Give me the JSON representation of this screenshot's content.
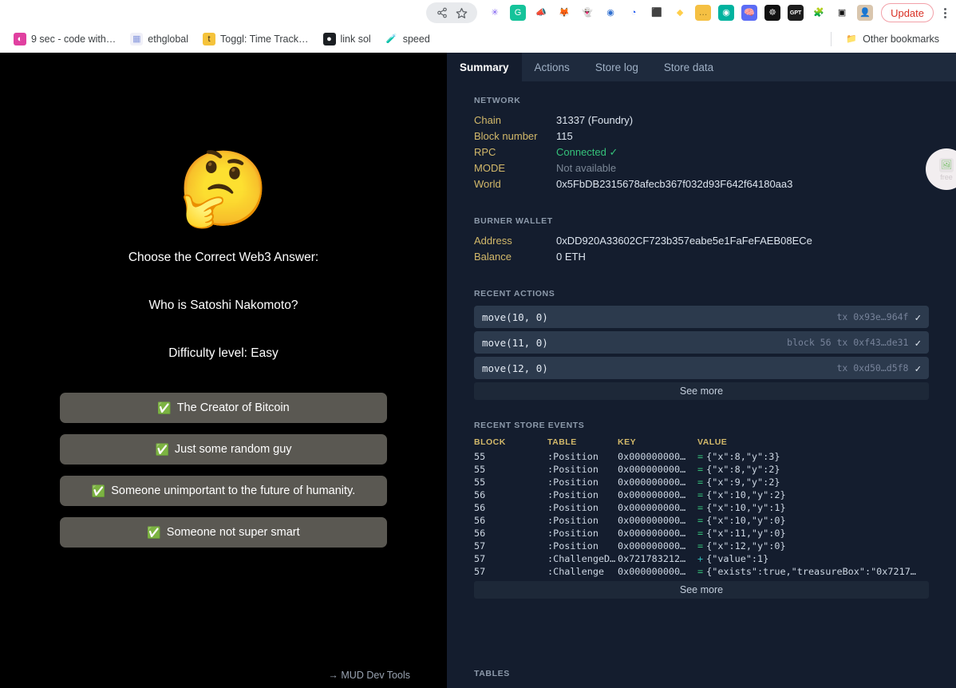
{
  "browser": {
    "omnibox_actions": [
      {
        "name": "share-icon",
        "glyph": "↪"
      },
      {
        "name": "bookmark-star-icon",
        "glyph": "☆"
      }
    ],
    "extensions": [
      {
        "name": "sun-extension-icon",
        "glyph": "✳",
        "color": "#7b5cf0",
        "bg": "#ffffff"
      },
      {
        "name": "grammarly-extension-icon",
        "glyph": "G",
        "color": "#ffffff",
        "bg": "#15c39a"
      },
      {
        "name": "megaphone-extension-icon",
        "glyph": "📣",
        "color": "#222222",
        "bg": "#ffffff"
      },
      {
        "name": "metamask-extension-icon",
        "glyph": "🦊",
        "color": "#e2761b",
        "bg": "#ffffff"
      },
      {
        "name": "ghost-extension-icon",
        "glyph": "👻",
        "color": "#b9c7d6",
        "bg": "#ffffff"
      },
      {
        "name": "opera-wallet-extension-icon",
        "glyph": "◉",
        "color": "#2f6fd0",
        "bg": "#ffffff"
      },
      {
        "name": "coinbase-wallet-extension-icon",
        "glyph": "◔",
        "color": "#1652f0",
        "bg": "#ffffff"
      },
      {
        "name": "figma-extension-icon",
        "glyph": "⬛",
        "color": "#e0407a",
        "bg": "#ffffff"
      },
      {
        "name": "rainbow-extension-icon",
        "glyph": "◆",
        "color": "#ffce4a",
        "bg": "#ffffff"
      },
      {
        "name": "notes-extension-icon",
        "glyph": "…",
        "color": "#8a6d1f",
        "bg": "#f5c043"
      },
      {
        "name": "loom-extension-icon",
        "glyph": "◉",
        "color": "#ffffff",
        "bg": "#00b39f"
      },
      {
        "name": "brain-chat-extension-icon",
        "glyph": "🧠",
        "color": "#ffffff",
        "bg": "#5b6cf5"
      },
      {
        "name": "dark-globe-extension-icon",
        "glyph": "☸",
        "color": "#cccccc",
        "bg": "#111111"
      },
      {
        "name": "gpt-extension-icon",
        "glyph": "GPT",
        "color": "#ffffff",
        "bg": "#1d1d1d"
      },
      {
        "name": "extensions-puzzle-icon",
        "glyph": "🧩",
        "color": "#3c4043",
        "bg": "#ffffff"
      },
      {
        "name": "sidepanel-icon",
        "glyph": "▣",
        "color": "#111111",
        "bg": "#ffffff"
      },
      {
        "name": "profile-avatar",
        "glyph": "👤",
        "color": "#5a4632",
        "bg": "#d9c6ae"
      }
    ],
    "update_label": "Update",
    "bookmarks": [
      {
        "label": "9 sec - code with…",
        "icon": "◐",
        "color": "#ffffff",
        "bg": "#e040a0"
      },
      {
        "label": "ethglobal",
        "icon": "▦",
        "color": "#8899dd",
        "bg": "#f0f0f8"
      },
      {
        "label": "Toggl: Time Track…",
        "icon": "t",
        "color": "#3b2c1a",
        "bg": "#f5c33b"
      },
      {
        "label": "link sol",
        "icon": "●",
        "color": "#ffffff",
        "bg": "#1b1f23"
      },
      {
        "label": "speed",
        "icon": "🧪",
        "color": "#4fbfc4",
        "bg": "#ffffff"
      }
    ],
    "other_bookmarks_label": "Other bookmarks",
    "other_bookmarks_icon": "📁"
  },
  "game": {
    "emoji": "🤔",
    "heading": "Choose the Correct Web3 Answer:",
    "question": "Who is Satoshi Nakomoto?",
    "difficulty": "Difficulty level: Easy",
    "answers": [
      {
        "check": "✅",
        "label": "The Creator of Bitcoin"
      },
      {
        "check": "✅",
        "label": "Just some random guy"
      },
      {
        "check": "✅",
        "label": "Someone unimportant to the future of humanity."
      },
      {
        "check": "✅",
        "label": "Someone not super smart"
      }
    ],
    "devtools_link": "→ MUD Dev Tools"
  },
  "devtools": {
    "tabs": [
      {
        "label": "Summary",
        "active": true
      },
      {
        "label": "Actions",
        "active": false
      },
      {
        "label": "Store log",
        "active": false
      },
      {
        "label": "Store data",
        "active": false
      }
    ],
    "network": {
      "title": "NETWORK",
      "rows": [
        {
          "key": "Chain",
          "value": "31337 (Foundry)",
          "style": ""
        },
        {
          "key": "Block number",
          "value": "115",
          "style": ""
        },
        {
          "key": "RPC",
          "value": "Connected ✓",
          "style": "green"
        },
        {
          "key": "MODE",
          "value": "Not available",
          "style": "muted"
        },
        {
          "key": "World",
          "value": "0x5FbDB2315678afecb367f032d93F642f64180aa3",
          "style": ""
        }
      ]
    },
    "wallet": {
      "title": "BURNER WALLET",
      "rows": [
        {
          "key": "Address",
          "value": "0xDD920A33602CF723b357eabe5e1FaFeFAEB08ECe",
          "style": ""
        },
        {
          "key": "Balance",
          "value": "0 ETH",
          "style": ""
        }
      ]
    },
    "recent_actions": {
      "title": "RECENT ACTIONS",
      "see_more": "See more",
      "rows": [
        {
          "call": "move(10, 0)",
          "meta": "tx 0x93e…964f",
          "status": "✓"
        },
        {
          "call": "move(11, 0)",
          "meta": "block 56 tx 0xf43…de31",
          "status": "✓"
        },
        {
          "call": "move(12, 0)",
          "meta": "tx 0xd50…d5f8",
          "status": "✓"
        }
      ]
    },
    "store_events": {
      "title": "RECENT STORE EVENTS",
      "see_more": "See more",
      "columns": [
        "BLOCK",
        "TABLE",
        "KEY",
        "VALUE"
      ],
      "rows": [
        {
          "block": "55",
          "table": ":Position",
          "key": "0x000000000…",
          "op": "=",
          "value": "{\"x\":8,\"y\":3}"
        },
        {
          "block": "55",
          "table": ":Position",
          "key": "0x000000000…",
          "op": "=",
          "value": "{\"x\":8,\"y\":2}"
        },
        {
          "block": "55",
          "table": ":Position",
          "key": "0x000000000…",
          "op": "=",
          "value": "{\"x\":9,\"y\":2}"
        },
        {
          "block": "56",
          "table": ":Position",
          "key": "0x000000000…",
          "op": "=",
          "value": "{\"x\":10,\"y\":2}"
        },
        {
          "block": "56",
          "table": ":Position",
          "key": "0x000000000…",
          "op": "=",
          "value": "{\"x\":10,\"y\":1}"
        },
        {
          "block": "56",
          "table": ":Position",
          "key": "0x000000000…",
          "op": "=",
          "value": "{\"x\":10,\"y\":0}"
        },
        {
          "block": "56",
          "table": ":Position",
          "key": "0x000000000…",
          "op": "=",
          "value": "{\"x\":11,\"y\":0}"
        },
        {
          "block": "57",
          "table": ":Position",
          "key": "0x000000000…",
          "op": "=",
          "value": "{\"x\":12,\"y\":0}"
        },
        {
          "block": "57",
          "table": ":ChallengeD…",
          "key": "0x721783212…",
          "op": "+",
          "value": "{\"value\":1}"
        },
        {
          "block": "57",
          "table": ":Challenge",
          "key": "0x000000000…",
          "op": "=",
          "value": "{\"exists\":true,\"treasureBox\":\"0x7217…"
        }
      ]
    },
    "tables_title": "TABLES"
  },
  "float_badge": {
    "icon": "🖼",
    "label": "free"
  }
}
